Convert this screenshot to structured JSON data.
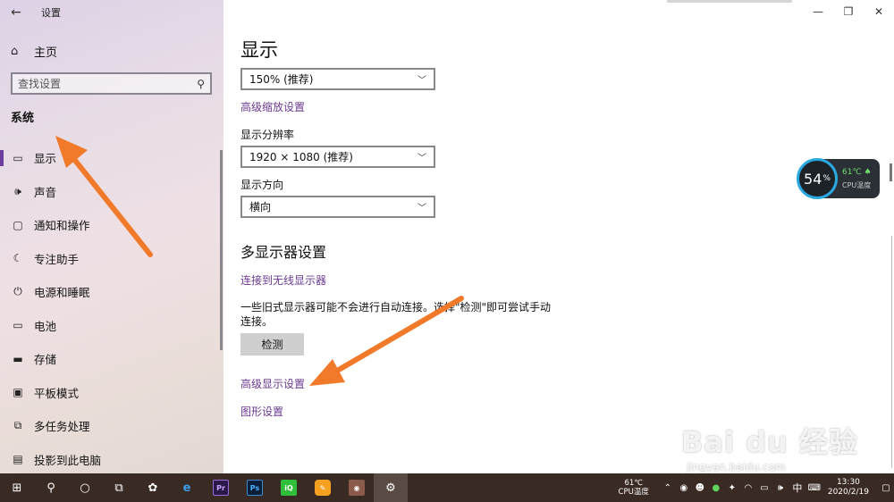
{
  "app": {
    "title": "设置"
  },
  "sidebar": {
    "home_label": "主页",
    "search_placeholder": "查找设置",
    "section": "系统",
    "items": [
      {
        "label": "显示",
        "icon": "monitor-icon"
      },
      {
        "label": "声音",
        "icon": "speaker-icon"
      },
      {
        "label": "通知和操作",
        "icon": "notification-icon"
      },
      {
        "label": "专注助手",
        "icon": "moon-icon"
      },
      {
        "label": "电源和睡眠",
        "icon": "power-icon"
      },
      {
        "label": "电池",
        "icon": "battery-icon"
      },
      {
        "label": "存储",
        "icon": "storage-icon"
      },
      {
        "label": "平板模式",
        "icon": "tablet-icon"
      },
      {
        "label": "多任务处理",
        "icon": "multitask-icon"
      },
      {
        "label": "投影到此电脑",
        "icon": "project-icon"
      }
    ]
  },
  "main": {
    "title": "显示",
    "scale_value": "150% (推荐)",
    "advanced_scale_link": "高级缩放设置",
    "resolution_label": "显示分辨率",
    "resolution_value": "1920 × 1080 (推荐)",
    "orientation_label": "显示方向",
    "orientation_value": "横向",
    "multi_display_heading": "多显示器设置",
    "wireless_link": "连接到无线显示器",
    "detect_description": "一些旧式显示器可能不会进行自动连接。选择\"检测\"即可尝试手动连接。",
    "detect_button": "检测",
    "advanced_display_link": "高级显示设置",
    "graphics_link": "图形设置"
  },
  "cpu_widget": {
    "percent": "54",
    "unit": "%",
    "temp": "61℃",
    "label": "CPU温度"
  },
  "taskbar": {
    "tray_temp": "61℃",
    "tray_temp_label": "CPU温度",
    "lang": "中",
    "time": "13:30",
    "date": "2020/2/19"
  },
  "watermark": {
    "main": "Bai du 经验",
    "sub": "jingyan.baidu.com"
  },
  "colors": {
    "accent": "#6b3fa0",
    "link": "#6b3a92",
    "arrow": "#f07a2a",
    "taskbar": "#3a2a24"
  }
}
